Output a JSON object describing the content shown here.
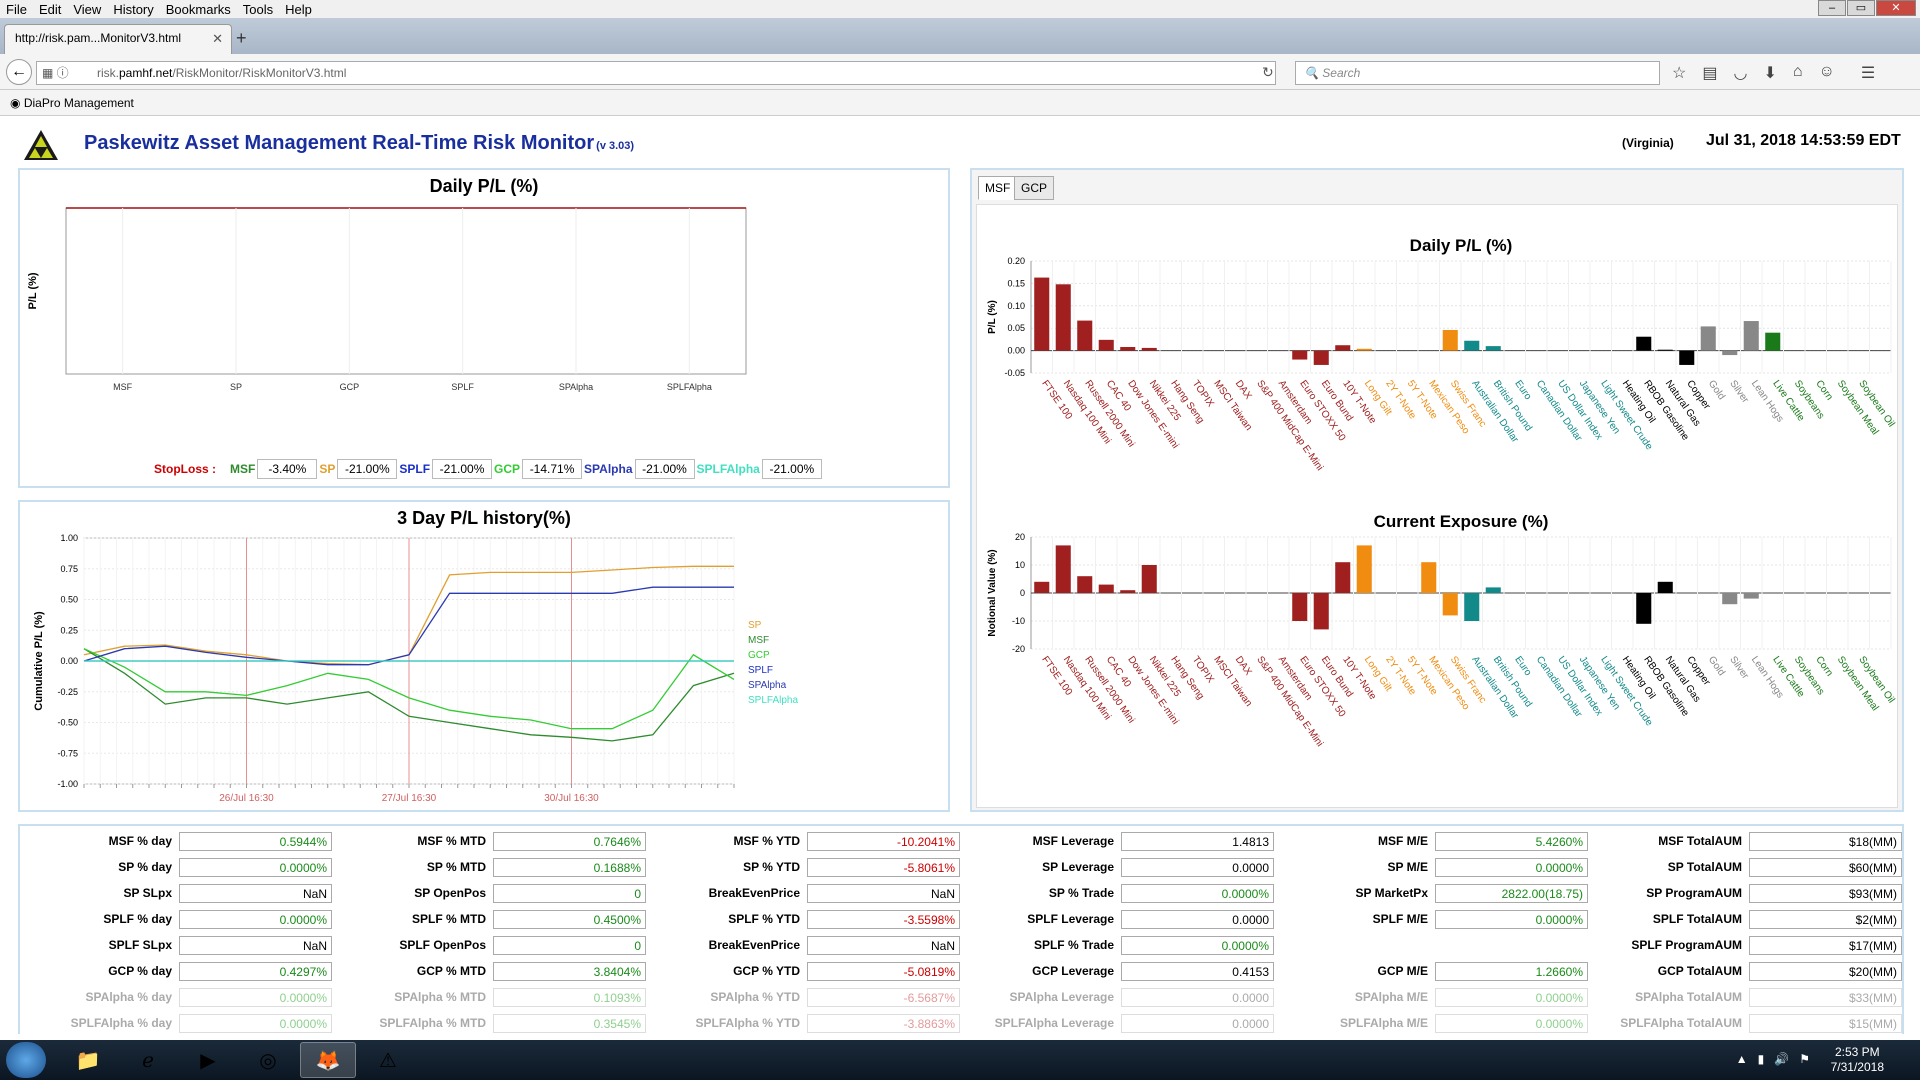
{
  "browser": {
    "menu": [
      "File",
      "Edit",
      "View",
      "History",
      "Bookmarks",
      "Tools",
      "Help"
    ],
    "tab_title": "http://risk.pam...MonitorV3.html",
    "url_prefix": "risk.",
    "url_domain": "pamhf.net",
    "url_path": "/RiskMonitor/RiskMonitorV3.html",
    "search_placeholder": "Search",
    "bookmark": "DiaPro Management"
  },
  "header": {
    "title": "Paskewitz Asset Management Real-Time Risk Monitor",
    "version": "(v 3.03)",
    "location": "(Virginia)",
    "datetime": "Jul 31, 2018 14:53:59 EDT"
  },
  "colors": {
    "MSF": "#2e8b2e",
    "SP": "#e0a030",
    "SPLF": "#1a2fc8",
    "GCP": "#33cc33",
    "SPAlpha": "#2a3ab0",
    "SPLFAlpha": "#40e0c0",
    "equity": "#a02020",
    "bond": "#f08c10",
    "currency": "#138a8a",
    "energy": "#000000",
    "metal": "#888888",
    "agri": "#1a7a1a"
  },
  "daily_panel": {
    "title": "Daily P/L (%)",
    "ylabel": "P/L (%)",
    "categories": [
      "MSF",
      "SP",
      "GCP",
      "SPLF",
      "SPAlpha",
      "SPLFAlpha"
    ],
    "stoploss_label": "StopLoss :",
    "stoploss": [
      {
        "name": "MSF",
        "value": "-3.40%"
      },
      {
        "name": "SP",
        "value": "-21.00%"
      },
      {
        "name": "SPLF",
        "value": "-21.00%"
      },
      {
        "name": "GCP",
        "value": "-14.71%"
      },
      {
        "name": "SPAlpha",
        "value": "-21.00%"
      },
      {
        "name": "SPLFAlpha",
        "value": "-21.00%"
      }
    ]
  },
  "history_panel": {
    "title": "3 Day P/L history(%)",
    "ylabel": "Cumulative P/L (%)",
    "yticks": [
      "1.00",
      "0.75",
      "0.50",
      "0.25",
      "0.00",
      "-0.25",
      "-0.50",
      "-0.75",
      "-1.00"
    ],
    "xticks": [
      "26/Jul 16:30",
      "27/Jul 16:30",
      "30/Jul 16:30"
    ],
    "legend": [
      "SP",
      "MSF",
      "GCP",
      "SPLF",
      "SPAlpha",
      "SPLFAlpha"
    ]
  },
  "right_panel": {
    "tabs": [
      "MSF",
      "GCP"
    ],
    "instrument_groups": [
      "equity",
      "equity",
      "equity",
      "equity",
      "equity",
      "equity",
      "equity",
      "equity",
      "equity",
      "equity",
      "equity",
      "equity",
      "equity",
      "equity",
      "equity",
      "bond",
      "bond",
      "bond",
      "bond",
      "bond",
      "currency",
      "currency",
      "currency",
      "currency",
      "currency",
      "currency",
      "currency",
      "energy",
      "energy",
      "energy",
      "energy",
      "metal",
      "metal",
      "metal",
      "agri",
      "agri",
      "agri",
      "agri",
      "agri",
      "agri"
    ]
  },
  "chart_data": [
    {
      "type": "bar",
      "title": "Daily P/L (%)",
      "ylabel": "P/L (%)",
      "ylim": [
        -0.05,
        0.2
      ],
      "yticks": [
        "0.20",
        "0.15",
        "0.10",
        "0.05",
        "0.00",
        "-0.05"
      ],
      "categories": [
        "FTSE 100",
        "Nasdaq 100 Mini",
        "Russell 2000 Mini",
        "CAC 40",
        "Dow Jones E-mini",
        "Nikkei 225",
        "Hang Seng",
        "TOPIX",
        "MSCI Taiwan",
        "DAX",
        "S&P 400 MidCap E-Mini",
        "Amsterdam",
        "Euro STOXX 50",
        "Euro Bund",
        "10Y T-Note",
        "Long Gilt",
        "2Y T-Note",
        "5Y T-Note",
        "Mexican Peso",
        "Swiss Franc",
        "Australian Dollar",
        "British Pound",
        "Euro",
        "Canadian Dollar",
        "US Dollar Index",
        "Japanese Yen",
        "Light Sweet Crude",
        "Heating Oil",
        "RBOB Gasoline",
        "Natural Gas",
        "Copper",
        "Gold",
        "Silver",
        "Lean Hogs",
        "Live Cattle",
        "Soybeans",
        "Corn",
        "Soybean Meal",
        "Soybean Oil"
      ],
      "values": [
        0.163,
        0.148,
        0.067,
        0.024,
        0.008,
        0.006,
        0,
        0,
        0,
        0,
        0,
        0,
        -0.02,
        -0.032,
        0.012,
        0.004,
        0,
        0,
        0,
        0.046,
        0.022,
        0.01,
        0,
        0,
        0,
        0,
        0,
        0,
        0.031,
        0.002,
        -0.032,
        0.054,
        -0.01,
        0.066,
        0.04,
        0,
        0,
        0,
        0,
        0
      ]
    },
    {
      "type": "bar",
      "title": "Current Exposure (%)",
      "ylabel": "Notional Value (%)",
      "ylim": [
        -20,
        20
      ],
      "yticks": [
        "20",
        "10",
        "0",
        "-10",
        "-20"
      ],
      "categories": [
        "FTSE 100",
        "Nasdaq 100 Mini",
        "Russell 2000 Mini",
        "CAC 40",
        "Dow Jones E-mini",
        "Nikkei 225",
        "Hang Seng",
        "TOPIX",
        "MSCI Taiwan",
        "DAX",
        "S&P 400 MidCap E-Mini",
        "Amsterdam",
        "Euro STOXX 50",
        "Euro Bund",
        "10Y T-Note",
        "Long Gilt",
        "2Y T-Note",
        "5Y T-Note",
        "Mexican Peso",
        "Swiss Franc",
        "Australian Dollar",
        "British Pound",
        "Euro",
        "Canadian Dollar",
        "US Dollar Index",
        "Japanese Yen",
        "Light Sweet Crude",
        "Heating Oil",
        "RBOB Gasoline",
        "Natural Gas",
        "Copper",
        "Gold",
        "Silver",
        "Lean Hogs",
        "Live Cattle",
        "Soybeans",
        "Corn",
        "Soybean Meal",
        "Soybean Oil"
      ],
      "values": [
        4,
        17,
        6,
        3,
        1,
        10,
        0,
        0,
        0,
        0,
        0,
        0,
        -10,
        -13,
        11,
        17,
        0,
        0,
        11,
        -8,
        -10,
        2,
        0,
        0,
        0,
        0,
        0,
        0,
        -11,
        4,
        0,
        0,
        -4,
        -2,
        0,
        0,
        0,
        0,
        0,
        0
      ]
    },
    {
      "type": "line",
      "title": "3 Day P/L history(%)",
      "ylabel": "Cumulative P/L (%)",
      "ylim": [
        -1,
        1
      ],
      "x": [
        "26/Jul 16:30",
        "27/Jul 16:30",
        "30/Jul 16:30"
      ],
      "series": [
        {
          "name": "SP",
          "values": [
            0.05,
            0.12,
            0.13,
            0.08,
            0.05,
            0.0,
            -0.02,
            -0.03,
            0.05,
            0.7,
            0.72,
            0.72,
            0.72,
            0.74,
            0.76,
            0.77,
            0.77
          ]
        },
        {
          "name": "MSF",
          "values": [
            0.1,
            -0.1,
            -0.35,
            -0.3,
            -0.3,
            -0.35,
            -0.3,
            -0.25,
            -0.45,
            -0.5,
            -0.55,
            -0.6,
            -0.62,
            -0.65,
            -0.6,
            -0.2,
            -0.1
          ]
        },
        {
          "name": "GCP",
          "values": [
            0.1,
            -0.05,
            -0.25,
            -0.25,
            -0.28,
            -0.2,
            -0.1,
            -0.15,
            -0.3,
            -0.4,
            -0.45,
            -0.48,
            -0.55,
            -0.55,
            -0.4,
            0.05,
            -0.15
          ]
        },
        {
          "name": "SPLF",
          "values": [
            0.0,
            0.0,
            0.0,
            0.0,
            0.0,
            0.0,
            0.0,
            0.0,
            0.0,
            0.0,
            0.0,
            0.0,
            0.0,
            0.0,
            0.0,
            0.0,
            0.0
          ]
        },
        {
          "name": "SPAlpha",
          "values": [
            0.0,
            0.1,
            0.12,
            0.07,
            0.03,
            0.0,
            -0.03,
            -0.03,
            0.05,
            0.55,
            0.55,
            0.55,
            0.55,
            0.55,
            0.6,
            0.6,
            0.6
          ]
        },
        {
          "name": "SPLFAlpha",
          "values": [
            0.0,
            0.0,
            0.0,
            0.0,
            0.0,
            0.0,
            0.0,
            0.0,
            0.0,
            0.0,
            0.0,
            0.0,
            0.0,
            0.0,
            0.0,
            0.0,
            0.0
          ]
        }
      ]
    }
  ],
  "stats": {
    "columns": [
      [
        {
          "label": "MSF % day",
          "value": "0.5944%",
          "cls": "pos"
        },
        {
          "label": "SP % day",
          "value": "0.0000%",
          "cls": "pos"
        },
        {
          "label": "SP SLpx",
          "value": "NaN",
          "cls": ""
        },
        {
          "label": "SPLF % day",
          "value": "0.0000%",
          "cls": "pos"
        },
        {
          "label": "SPLF SLpx",
          "value": "NaN",
          "cls": ""
        },
        {
          "label": "GCP % day",
          "value": "0.4297%",
          "cls": "pos"
        },
        {
          "label": "SPAlpha % day",
          "value": "0.0000%",
          "cls": "pos",
          "faded": true
        },
        {
          "label": "SPLFAlpha % day",
          "value": "0.0000%",
          "cls": "pos",
          "faded": true
        }
      ],
      [
        {
          "label": "MSF % MTD",
          "value": "0.7646%",
          "cls": "pos"
        },
        {
          "label": "SP % MTD",
          "value": "0.1688%",
          "cls": "pos"
        },
        {
          "label": "SP OpenPos",
          "value": "0",
          "cls": "pos"
        },
        {
          "label": "SPLF % MTD",
          "value": "0.4500%",
          "cls": "pos"
        },
        {
          "label": "SPLF OpenPos",
          "value": "0",
          "cls": "pos"
        },
        {
          "label": "GCP % MTD",
          "value": "3.8404%",
          "cls": "pos"
        },
        {
          "label": "SPAlpha % MTD",
          "value": "0.1093%",
          "cls": "pos",
          "faded": true
        },
        {
          "label": "SPLFAlpha % MTD",
          "value": "0.3545%",
          "cls": "pos",
          "faded": true
        }
      ],
      [
        {
          "label": "MSF % YTD",
          "value": "-10.2041%",
          "cls": "neg"
        },
        {
          "label": "SP % YTD",
          "value": "-5.8061%",
          "cls": "neg"
        },
        {
          "label": "BreakEvenPrice",
          "value": "NaN",
          "cls": ""
        },
        {
          "label": "SPLF % YTD",
          "value": "-3.5598%",
          "cls": "neg"
        },
        {
          "label": "BreakEvenPrice",
          "value": "NaN",
          "cls": ""
        },
        {
          "label": "GCP % YTD",
          "value": "-5.0819%",
          "cls": "neg"
        },
        {
          "label": "SPAlpha % YTD",
          "value": "-6.5687%",
          "cls": "neg",
          "faded": true
        },
        {
          "label": "SPLFAlpha % YTD",
          "value": "-3.8863%",
          "cls": "neg",
          "faded": true
        }
      ],
      [
        {
          "label": "MSF Leverage",
          "value": "1.4813",
          "cls": ""
        },
        {
          "label": "SP Leverage",
          "value": "0.0000",
          "cls": ""
        },
        {
          "label": "SP % Trade",
          "value": "0.0000%",
          "cls": "pos"
        },
        {
          "label": "SPLF Leverage",
          "value": "0.0000",
          "cls": ""
        },
        {
          "label": "SPLF % Trade",
          "value": "0.0000%",
          "cls": "pos"
        },
        {
          "label": "GCP Leverage",
          "value": "0.4153",
          "cls": ""
        },
        {
          "label": "SPAlpha Leverage",
          "value": "0.0000",
          "cls": "",
          "faded": true
        },
        {
          "label": "SPLFAlpha Leverage",
          "value": "0.0000",
          "cls": "",
          "faded": true
        }
      ],
      [
        {
          "label": "MSF M/E",
          "value": "5.4260%",
          "cls": "pos"
        },
        {
          "label": "SP M/E",
          "value": "0.0000%",
          "cls": "pos"
        },
        {
          "label": "SP MarketPx",
          "value": "2822.00(18.75)",
          "cls": "pos"
        },
        {
          "label": "SPLF M/E",
          "value": "0.0000%",
          "cls": "pos"
        },
        {
          "label": "",
          "value": "",
          "cls": "",
          "empty": true
        },
        {
          "label": "GCP M/E",
          "value": "1.2660%",
          "cls": "pos"
        },
        {
          "label": "SPAlpha M/E",
          "value": "0.0000%",
          "cls": "pos",
          "faded": true
        },
        {
          "label": "SPLFAlpha M/E",
          "value": "0.0000%",
          "cls": "pos",
          "faded": true
        }
      ],
      [
        {
          "label": "MSF TotalAUM",
          "value": "$18(MM)",
          "cls": ""
        },
        {
          "label": "SP TotalAUM",
          "value": "$60(MM)",
          "cls": ""
        },
        {
          "label": "SP ProgramAUM",
          "value": "$93(MM)",
          "cls": ""
        },
        {
          "label": "SPLF TotalAUM",
          "value": "$2(MM)",
          "cls": ""
        },
        {
          "label": "SPLF ProgramAUM",
          "value": "$17(MM)",
          "cls": ""
        },
        {
          "label": "GCP TotalAUM",
          "value": "$20(MM)",
          "cls": ""
        },
        {
          "label": "SPAlpha TotalAUM",
          "value": "$33(MM)",
          "cls": "",
          "faded": true
        },
        {
          "label": "SPLFAlpha TotalAUM",
          "value": "$15(MM)",
          "cls": "",
          "faded": true
        }
      ]
    ]
  },
  "taskbar": {
    "time": "2:53 PM",
    "date": "7/31/2018"
  }
}
